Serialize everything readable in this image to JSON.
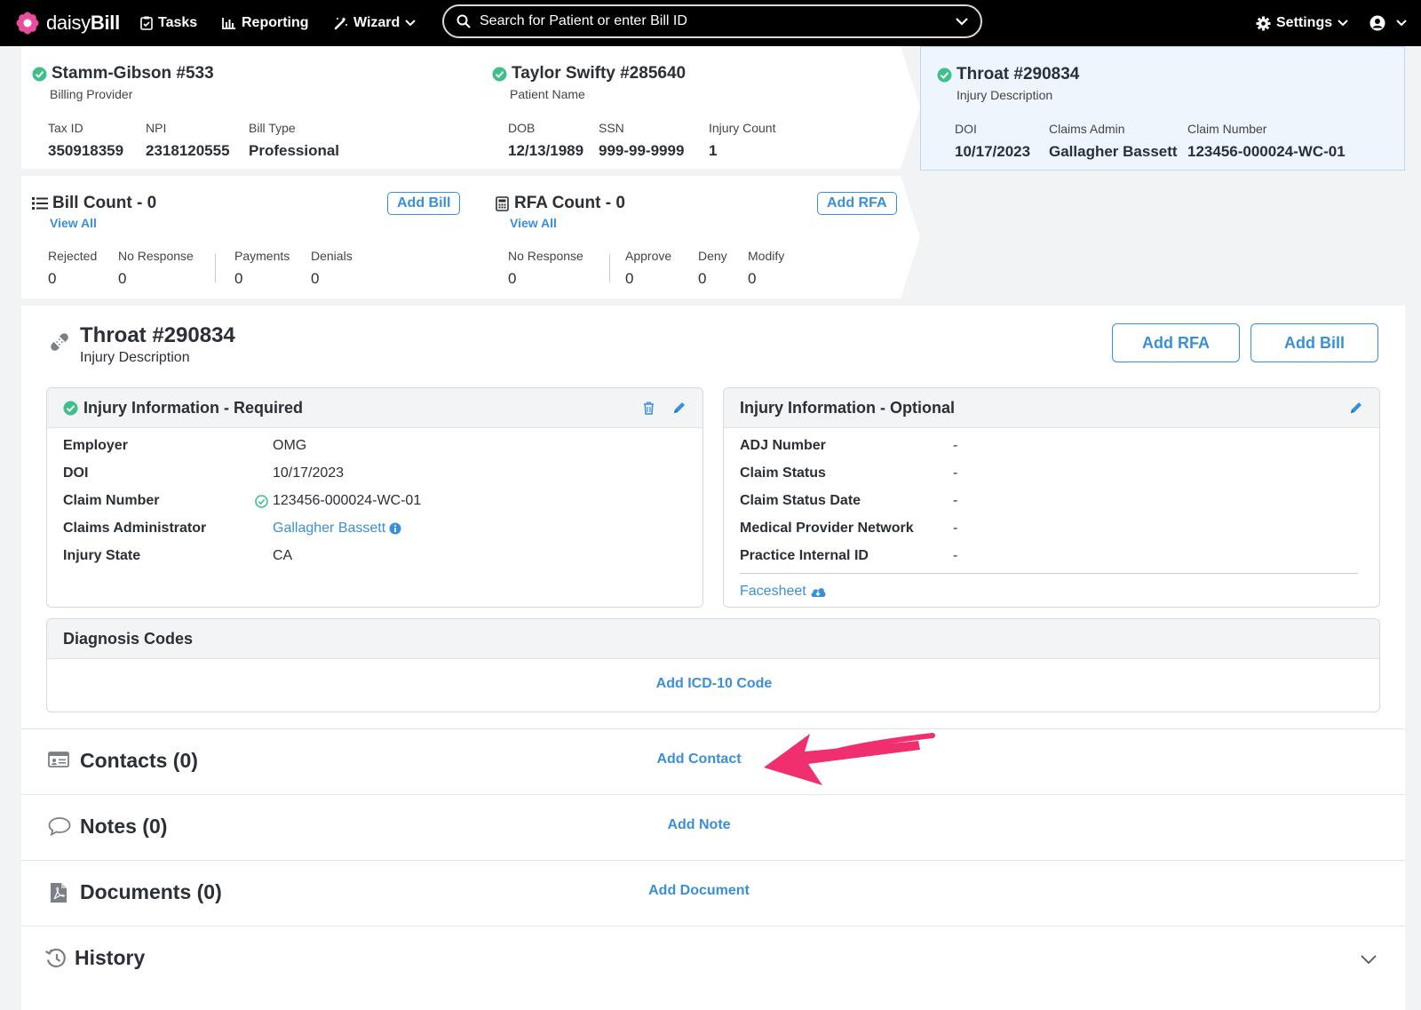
{
  "nav": {
    "brand_prefix": "daisy",
    "brand_suffix": "Bill",
    "tasks": "Tasks",
    "reporting": "Reporting",
    "wizard": "Wizard",
    "search_placeholder": "Search for Patient or enter Bill ID",
    "settings": "Settings"
  },
  "provider": {
    "title": "Stamm-Gibson #533",
    "subtitle": "Billing Provider",
    "fields": [
      {
        "label": "Tax ID",
        "value": "350918359"
      },
      {
        "label": "NPI",
        "value": "2318120555"
      },
      {
        "label": "Bill Type",
        "value": "Professional"
      }
    ]
  },
  "patient": {
    "title": "Taylor Swifty #285640",
    "subtitle": "Patient Name",
    "fields": [
      {
        "label": "DOB",
        "value": "12/13/1989"
      },
      {
        "label": "SSN",
        "value": "999-99-9999"
      },
      {
        "label": "Injury Count",
        "value": "1"
      }
    ]
  },
  "injury_card": {
    "title": "Throat #290834",
    "subtitle": "Injury Description",
    "fields": [
      {
        "label": "DOI",
        "value": "10/17/2023"
      },
      {
        "label": "Claims Admin",
        "value": "Gallagher Bassett"
      },
      {
        "label": "Claim Number",
        "value": "123456-000024-WC-01"
      }
    ]
  },
  "bills": {
    "title": "Bill Count - 0",
    "view_all": "View All",
    "add_label": "Add Bill",
    "stats": [
      {
        "label": "Rejected",
        "value": "0"
      },
      {
        "label": "No Response",
        "value": "0"
      },
      {
        "label": "Payments",
        "value": "0"
      },
      {
        "label": "Denials",
        "value": "0"
      }
    ]
  },
  "rfas": {
    "title": "RFA Count - 0",
    "view_all": "View All",
    "add_label": "Add RFA",
    "stats": [
      {
        "label": "No Response",
        "value": "0"
      },
      {
        "label": "Approve",
        "value": "0"
      },
      {
        "label": "Deny",
        "value": "0"
      },
      {
        "label": "Modify",
        "value": "0"
      }
    ]
  },
  "injury": {
    "name": "Throat #290834",
    "desc": "Injury Description",
    "add_rfa": "Add RFA",
    "add_bill": "Add Bill"
  },
  "required": {
    "title": "Injury Information - Required",
    "rows": [
      {
        "label": "Employer",
        "value": "OMG"
      },
      {
        "label": "DOI",
        "value": "10/17/2023"
      },
      {
        "label": "Claim Number",
        "value": "123456-000024-WC-01"
      },
      {
        "label": "Claims Administrator",
        "value": "Gallagher Bassett"
      },
      {
        "label": "Injury State",
        "value": "CA"
      }
    ]
  },
  "optional": {
    "title": "Injury Information - Optional",
    "rows": [
      {
        "label": "ADJ Number",
        "value": "-"
      },
      {
        "label": "Claim Status",
        "value": "-"
      },
      {
        "label": "Claim Status Date",
        "value": "-"
      },
      {
        "label": "Medical Provider Network",
        "value": "-"
      },
      {
        "label": "Practice Internal ID",
        "value": "-"
      }
    ],
    "facesheet": "Facesheet"
  },
  "diagnosis": {
    "title": "Diagnosis Codes",
    "add": "Add ICD-10 Code"
  },
  "sections": {
    "contacts": {
      "title": "Contacts (0)",
      "action": "Add Contact"
    },
    "notes": {
      "title": "Notes (0)",
      "action": "Add Note"
    },
    "documents": {
      "title": "Documents (0)",
      "action": "Add Document"
    },
    "history": {
      "title": "History"
    }
  },
  "colors": {
    "accent": "#3a8fd9",
    "check": "#3fbf8a",
    "highlight_arrow": "#f0306e",
    "selected_card": "#eef5fc"
  }
}
